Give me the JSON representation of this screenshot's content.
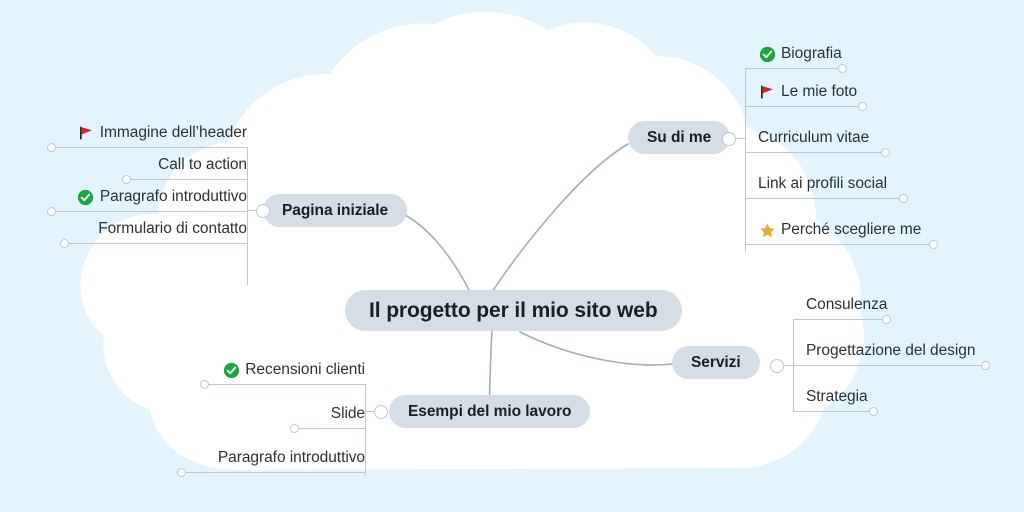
{
  "theme": {
    "background": "#e3f4fc",
    "cloud": "#ffffff",
    "pill_fill": "#d5dee6",
    "pill_text": "#182027",
    "leaf_text": "#2a3238",
    "line": "#bcc9d2",
    "check_green": "#1aa73d",
    "flag_red": "#d72323",
    "star_orange": "#f0a830"
  },
  "root": {
    "label": "Il progetto per il mio sito web"
  },
  "branches": [
    {
      "id": "pagina-iniziale",
      "label": "Pagina iniziale",
      "side": "left",
      "items": [
        {
          "label": "Immagine dell’header",
          "icon": "flag-icon"
        },
        {
          "label": "Call to action",
          "icon": null
        },
        {
          "label": "Paragrafo introduttivo",
          "icon": "check-icon"
        },
        {
          "label": "Formulario di contatto",
          "icon": null
        }
      ]
    },
    {
      "id": "su-di-me",
      "label": "Su di me",
      "side": "right",
      "items": [
        {
          "label": "Biografia",
          "icon": "check-icon"
        },
        {
          "label": "Le mie foto",
          "icon": "flag-icon"
        },
        {
          "label": "Curriculum vitae",
          "icon": null
        },
        {
          "label": "Link ai profili social",
          "icon": null
        },
        {
          "label": "Perché scegliere me",
          "icon": "star-icon"
        }
      ]
    },
    {
      "id": "servizi",
      "label": "Servizi",
      "side": "right",
      "items": [
        {
          "label": "Consulenza",
          "icon": null
        },
        {
          "label": "Progettazione del design",
          "icon": null
        },
        {
          "label": "Strategia",
          "icon": null
        }
      ]
    },
    {
      "id": "esempi-del-mio-lavoro",
      "label": "Esempi del mio lavoro",
      "side": "left",
      "items": [
        {
          "label": "Recensioni clienti",
          "icon": "check-icon"
        },
        {
          "label": "Slide",
          "icon": null
        },
        {
          "label": "Paragrafo introduttivo",
          "icon": null
        }
      ]
    }
  ]
}
